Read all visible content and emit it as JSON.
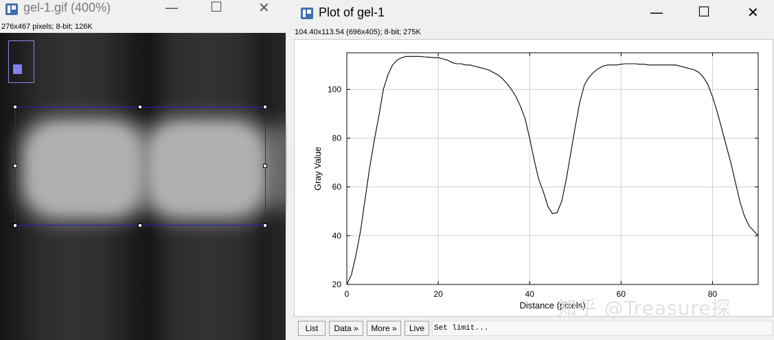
{
  "left_window": {
    "title": "gel-1.gif (400%)",
    "info": "276x467 pixels; 8-bit; 126K",
    "controls": {
      "minimize": "—",
      "maximize": "☐",
      "close": "✕"
    }
  },
  "right_window": {
    "title": "Plot of gel-1",
    "info": "104.40x113.54   (696x405); 8-bit; 275K",
    "controls": {
      "minimize": "—",
      "maximize": "☐",
      "close": "✕"
    },
    "buttons": {
      "list": "List",
      "data": "Data »",
      "more": "More »",
      "live": "Live"
    },
    "status_text": "Set limit..."
  },
  "icons": {
    "app_icon": "imagej-icon",
    "minimize": "minimize-icon",
    "maximize": "maximize-icon",
    "close": "close-icon"
  },
  "watermark": "知乎 @Treasure探",
  "chart_data": {
    "type": "line",
    "xlabel": "Distance (pixels)",
    "ylabel": "Gray Value",
    "xlim": [
      0,
      90
    ],
    "ylim": [
      20,
      115
    ],
    "x_ticks": [
      0,
      20,
      40,
      60,
      80
    ],
    "y_ticks": [
      20,
      40,
      60,
      80,
      100
    ],
    "grid": true,
    "series": [
      {
        "color": "#000000",
        "x": [
          0,
          1,
          2,
          3,
          4,
          5,
          6,
          7,
          8,
          9,
          10,
          11,
          12,
          13,
          14,
          15,
          16,
          17,
          18,
          19,
          20,
          21,
          22,
          23,
          24,
          25,
          26,
          27,
          28,
          29,
          30,
          31,
          32,
          33,
          34,
          35,
          36,
          37,
          38,
          39,
          40,
          41,
          42,
          43,
          44,
          45,
          46,
          47,
          48,
          49,
          50,
          51,
          52,
          53,
          54,
          55,
          56,
          57,
          58,
          59,
          60,
          61,
          62,
          63,
          64,
          65,
          66,
          67,
          68,
          69,
          70,
          71,
          72,
          73,
          74,
          75,
          76,
          77,
          78,
          79,
          80,
          81,
          82,
          83,
          84,
          85,
          86,
          87,
          88,
          89,
          90
        ],
        "y": [
          20,
          24,
          32,
          42,
          55,
          68,
          79,
          89,
          100,
          106,
          110,
          112,
          113,
          113.5,
          113.5,
          113.5,
          113.5,
          113.3,
          113.2,
          113,
          113,
          112.5,
          112,
          111,
          110.5,
          110.5,
          110,
          110,
          109.5,
          109,
          108.5,
          108,
          107,
          106,
          104.5,
          102.5,
          100,
          97,
          93,
          88,
          80,
          71,
          63,
          58,
          52,
          49,
          49.5,
          54,
          63,
          74,
          85,
          95,
          102,
          105,
          107,
          108.5,
          109.5,
          110,
          110,
          110,
          110.3,
          110.5,
          110.5,
          110.5,
          110.3,
          110.3,
          110,
          110,
          110,
          110,
          110,
          110,
          110,
          109.5,
          109,
          108.5,
          108,
          107,
          105,
          102,
          97,
          91,
          84,
          77,
          70,
          62,
          54,
          48,
          44,
          42,
          40
        ]
      }
    ]
  }
}
